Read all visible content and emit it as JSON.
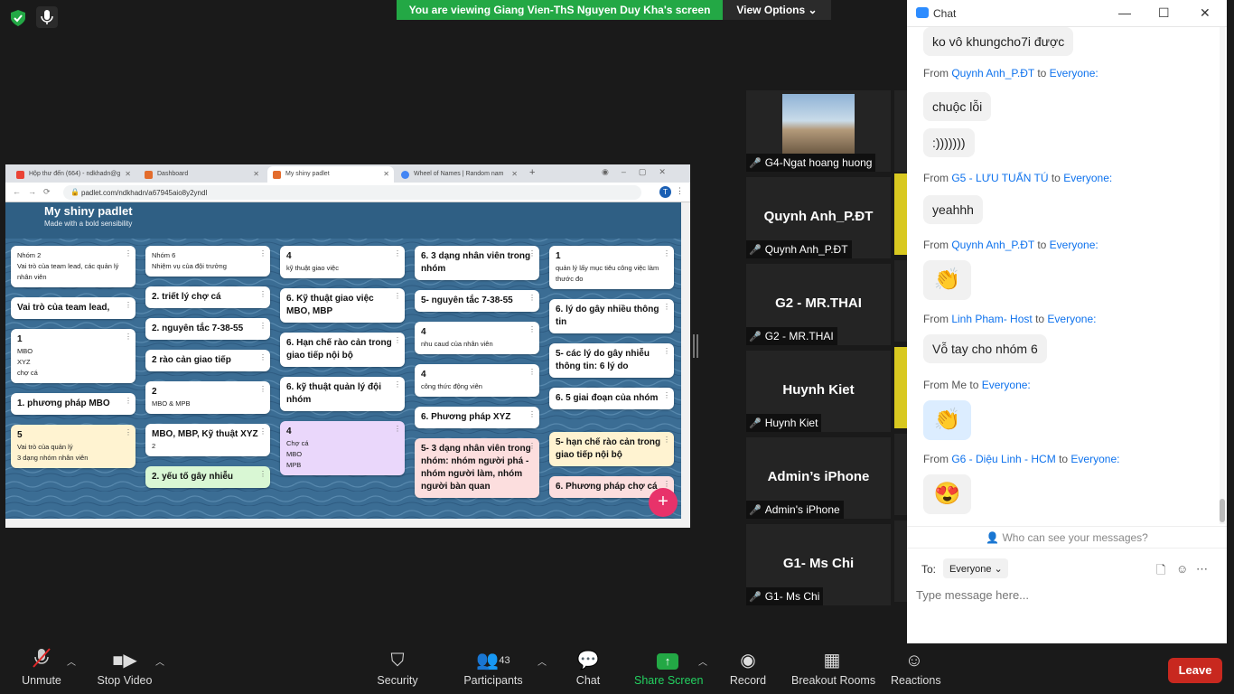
{
  "banner": {
    "viewing": "You are viewing Giang Vien-ThS Nguyen Duy Kha's screen",
    "view_options": "View Options"
  },
  "browser": {
    "tabs": [
      "Hộp thư đến (664) - ndkhadn@g",
      "Dashboard",
      "My shiny padlet",
      "Wheel of Names | Random nam"
    ],
    "url": "padlet.com/ndkhadn/a67945aio8y2yndl",
    "padlet_title": "My shiny padlet",
    "padlet_subtitle": "Made with a bold sensibility",
    "columns": [
      [
        {
          "title": "",
          "text": "Nhóm 2\nVai trò của team lead, các quản lý nhân viên",
          "color": "#ffffff"
        },
        {
          "title": "Vai trò của team lead,",
          "text": "",
          "color": "#ffffff"
        },
        {
          "title": "1",
          "text": "MBO\nXYZ\nchợ cá",
          "color": "#ffffff"
        },
        {
          "title": "1. phương pháp MBO",
          "text": "",
          "color": "#ffffff"
        },
        {
          "title": "5",
          "text": "Vai trò của quản lý\n3 dạng nhóm nhân viên",
          "color": "#fff3d1"
        }
      ],
      [
        {
          "title": "",
          "text": "Nhóm 6\nNhiệm vụ của đội trưởng",
          "color": "#ffffff"
        },
        {
          "title": "2. triết lý chợ cá",
          "text": "",
          "color": "#ffffff"
        },
        {
          "title": "2. nguyên tắc 7-38-55",
          "text": "",
          "color": "#ffffff"
        },
        {
          "title": "2 rào cản giao tiếp",
          "text": "",
          "color": "#ffffff"
        },
        {
          "title": "2",
          "text": "MBO & MPB",
          "color": "#ffffff"
        },
        {
          "title": "MBO, MBP, Kỹ thuật XYZ",
          "text": "2",
          "color": "#ffffff"
        },
        {
          "title": "2. yếu tố gây nhiễu",
          "text": "",
          "color": "#d9f7d4"
        }
      ],
      [
        {
          "title": "4",
          "text": "kỹ thuật giao việc",
          "color": "#ffffff"
        },
        {
          "title": "6. Kỹ thuật giao việc MBO, MBP",
          "text": "",
          "color": "#ffffff"
        },
        {
          "title": "6. Hạn chế rào cản trong giao tiếp nội bộ",
          "text": "",
          "color": "#ffffff"
        },
        {
          "title": "6. kỹ thuật quản lý đội nhóm",
          "text": "",
          "color": "#ffffff"
        },
        {
          "title": "4",
          "text": "Chợ cá\nMBO\nMPB",
          "color": "#ead7fb"
        }
      ],
      [
        {
          "title": "6. 3 dạng nhân viên trong nhóm",
          "text": "",
          "color": "#ffffff"
        },
        {
          "title": "5- nguyên tắc 7-38-55",
          "text": "",
          "color": "#ffffff"
        },
        {
          "title": "4",
          "text": "nhu caud của nhân viên",
          "color": "#ffffff"
        },
        {
          "title": "4",
          "text": "công thức động viên",
          "color": "#ffffff"
        },
        {
          "title": "6. Phương pháp XYZ",
          "text": "",
          "color": "#ffffff"
        },
        {
          "title": "5- 3 dạng nhân viên trong nhóm: nhóm người phá - nhóm người làm, nhóm người bàn quan",
          "text": "",
          "color": "#fcdede"
        }
      ],
      [
        {
          "title": "1",
          "text": "quản lý lấy mục tiêu công việc làm thước đo",
          "color": "#ffffff"
        },
        {
          "title": "6. lý do gây nhiều thông tin",
          "text": "",
          "color": "#ffffff"
        },
        {
          "title": "5- các lý do gây nhiễu thông tin: 6 lý do",
          "text": "",
          "color": "#ffffff"
        },
        {
          "title": "6. 5 giai đoạn của nhóm",
          "text": "",
          "color": "#ffffff"
        },
        {
          "title": "5- hạn chế rào cản trong giao tiếp nội bộ",
          "text": "",
          "color": "#fff3d1"
        },
        {
          "title": "6. Phương pháp chợ cá",
          "text": "",
          "color": "#fcdede"
        }
      ]
    ]
  },
  "tiles": [
    {
      "name": "",
      "label": "G4-Ngat hoang huong",
      "photo": true
    },
    {
      "name": "Quynh Anh_P.ĐT",
      "label": "Quynh Anh_P.ĐT"
    },
    {
      "name": "G2 - MR.THAI",
      "label": "G2 - MR.THAI"
    },
    {
      "name": "Huynh Kiet",
      "label": "Huynh Kiet"
    },
    {
      "name": "Admin’s iPhone",
      "label": "Admin's iPhone"
    },
    {
      "name": "G1- Ms Chi",
      "label": "G1- Ms Chi"
    }
  ],
  "chat": {
    "title": "Chat",
    "messages": [
      {
        "from": "",
        "to": "",
        "body": "ko vô khungcho7i được",
        "emoji": false
      },
      {
        "from": "Quynh Anh_P.ĐT",
        "to": "Everyone:",
        "body": "chuộc lỗi",
        "emoji": false
      },
      {
        "from": "",
        "to": "",
        "body": ":)))))))",
        "emoji": false
      },
      {
        "from": "G5 - LƯU TUẤN TÚ",
        "to": "Everyone:",
        "body": "yeahhh",
        "emoji": false
      },
      {
        "from": "Quynh Anh_P.ĐT",
        "to": "Everyone:",
        "body": "👏",
        "emoji": true
      },
      {
        "from": "Linh Pham- Host",
        "to": "Everyone:",
        "body": "Vỗ tay cho nhóm 6",
        "emoji": false
      },
      {
        "from": "Me",
        "to": "Everyone:",
        "body": "👏",
        "emoji": true,
        "me": true
      },
      {
        "from": "G6 - Diệu Linh - HCM",
        "to": "Everyone:",
        "body": "😍",
        "emoji": true
      }
    ],
    "from_word": "From",
    "to_word": "to",
    "who_can_see": "Who can see your messages?",
    "to_label": "To:",
    "to_value": "Everyone",
    "input_placeholder": "Type message here..."
  },
  "toolbar": {
    "unmute": "Unmute",
    "stop_video": "Stop Video",
    "security": "Security",
    "participants": "Participants",
    "participants_count": "43",
    "chat": "Chat",
    "share_screen": "Share Screen",
    "record": "Record",
    "breakout_rooms": "Breakout Rooms",
    "reactions": "Reactions",
    "leave": "Leave"
  },
  "colors": {
    "green": "#23a845",
    "blue_link": "#0e72ed",
    "leave_red": "#c8281f"
  }
}
